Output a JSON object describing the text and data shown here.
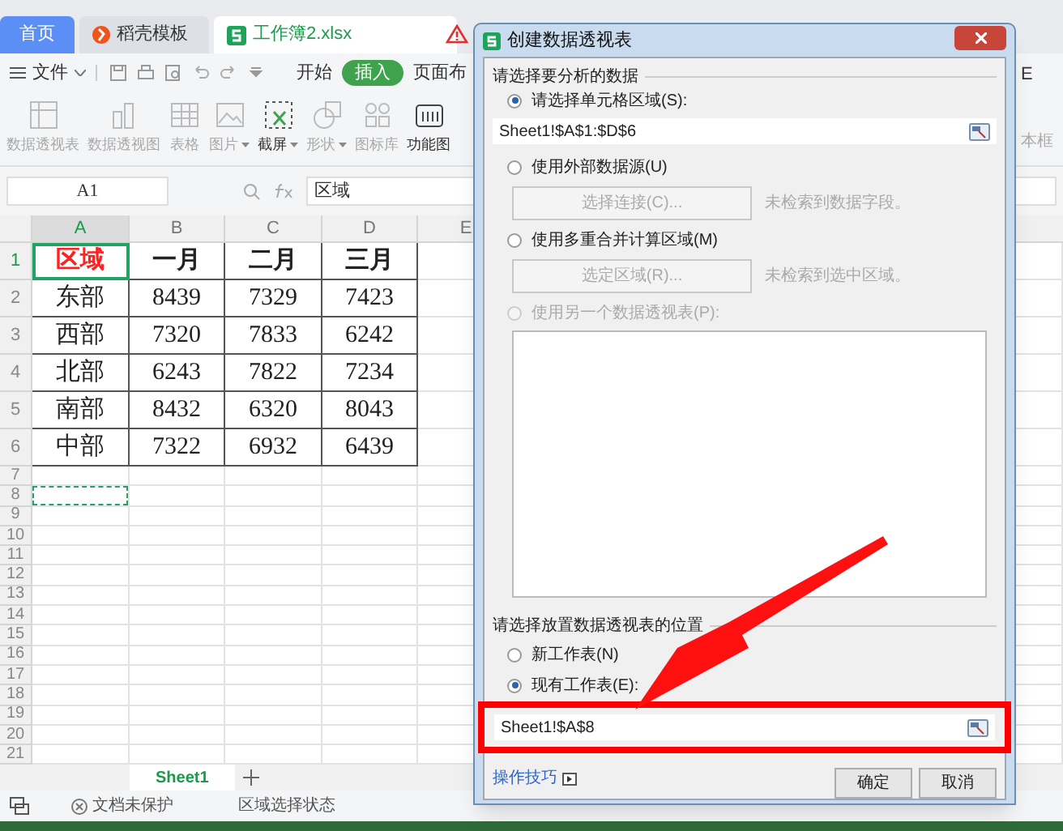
{
  "tabs": [
    {
      "label": "首页",
      "kind": "home",
      "selected": false
    },
    {
      "label": "稻壳模板",
      "kind": "template",
      "selected": false
    },
    {
      "label": "工作簿2.xlsx",
      "kind": "sheet",
      "selected": true
    }
  ],
  "menu": [
    {
      "label": "文件",
      "selected": false
    },
    {
      "label": "开始",
      "selected": false
    },
    {
      "label": "插入",
      "selected": true
    },
    {
      "label": "页面布",
      "selected": false
    }
  ],
  "menu_cut_text": "E",
  "ribbon": [
    {
      "label": "数据透视表",
      "kind": "pivot",
      "disabled": true,
      "dropdown": false
    },
    {
      "label": "数据透视图",
      "kind": "chart",
      "disabled": true,
      "dropdown": false
    },
    {
      "label": "表格",
      "kind": "table",
      "disabled": true,
      "dropdown": false
    },
    {
      "label": "图片",
      "kind": "image",
      "disabled": true,
      "dropdown": true
    },
    {
      "label": "截屏",
      "kind": "screenshot",
      "disabled": false,
      "dropdown": true
    },
    {
      "label": "形状",
      "kind": "shape",
      "disabled": true,
      "dropdown": true
    },
    {
      "label": "图标库",
      "kind": "icons",
      "disabled": true,
      "dropdown": false
    },
    {
      "label": "功能图",
      "kind": "function",
      "disabled": false,
      "dropdown": false
    }
  ],
  "ribbon_cut_text": "本框",
  "name_box": "A1",
  "formula": "区域",
  "sheet": {
    "columns": [
      {
        "label": "A",
        "selected": true
      },
      {
        "label": "B",
        "selected": false
      },
      {
        "label": "C",
        "selected": false
      },
      {
        "label": "D",
        "selected": false
      },
      {
        "label": "E",
        "selected": false
      }
    ],
    "row_numbers": [
      "1",
      "2",
      "3",
      "4",
      "5",
      "6",
      "7",
      "8",
      "9",
      "10",
      "11",
      "12",
      "13",
      "14",
      "15",
      "16",
      "17",
      "18",
      "19",
      "20",
      "21"
    ],
    "rows": [
      [
        "区域",
        "一月",
        "二月",
        "三月"
      ],
      [
        "东部",
        "8439",
        "7329",
        "7423"
      ],
      [
        "西部",
        "7320",
        "7833",
        "6242"
      ],
      [
        "北部",
        "6243",
        "7822",
        "7234"
      ],
      [
        "南部",
        "8432",
        "6320",
        "8043"
      ],
      [
        "中部",
        "7322",
        "6932",
        "6439"
      ]
    ]
  },
  "sheet_tabs": [
    {
      "label": "Sheet1",
      "selected": true
    }
  ],
  "status": [
    "文档未保护",
    "区域选择状态"
  ],
  "dialog": {
    "title": "创建数据透视表",
    "source_group": "请选择要分析的数据",
    "source_options": [
      {
        "kind": "range",
        "label": "请选择单元格区域(S):",
        "selected": true,
        "disabled": false,
        "value": "Sheet1!$A$1:$D$6"
      },
      {
        "kind": "button",
        "label": "使用外部数据源(U)",
        "selected": false,
        "disabled": false,
        "button": "选择连接(C)...",
        "note": "未检索到数据字段。"
      },
      {
        "kind": "button",
        "label": "使用多重合并计算区域(M)",
        "selected": false,
        "disabled": false,
        "button": "选定区域(R)...",
        "note": "未检索到选中区域。"
      },
      {
        "kind": "list",
        "label": "使用另一个数据透视表(P):",
        "selected": false,
        "disabled": true
      }
    ],
    "target_group": "请选择放置数据透视表的位置",
    "target_options": [
      {
        "label": "新工作表(N)",
        "selected": false
      },
      {
        "label": "现有工作表(E):",
        "selected": true
      }
    ],
    "target_value": "Sheet1!$A$8",
    "tips_link": "操作技巧",
    "buttons": [
      "确定",
      "取消"
    ]
  }
}
